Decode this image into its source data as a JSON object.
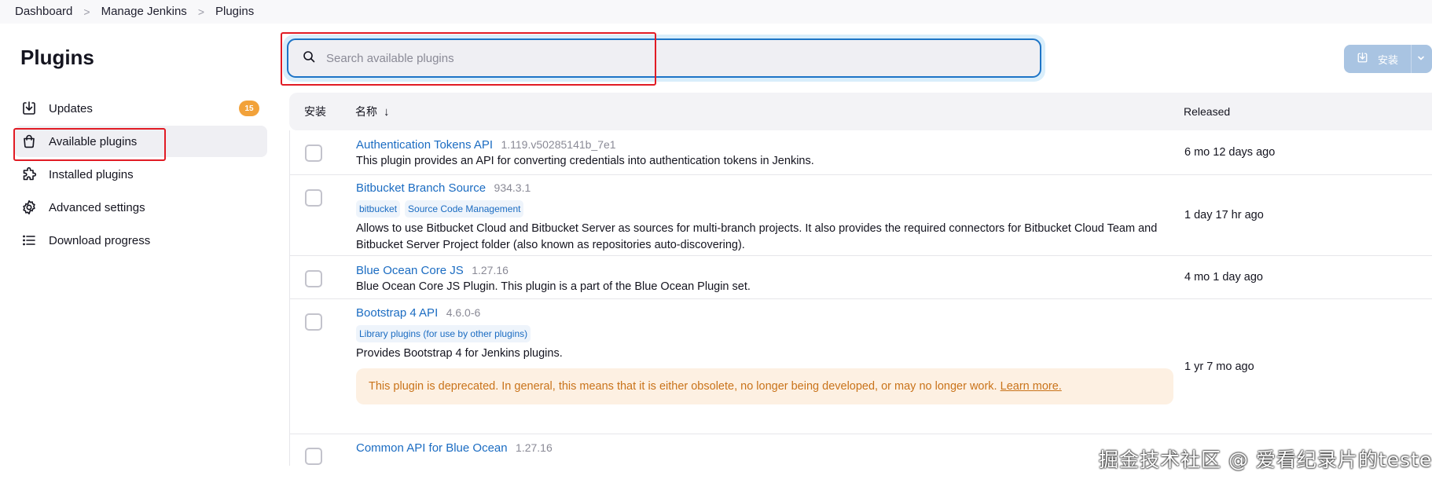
{
  "breadcrumb": [
    "Dashboard",
    "Manage Jenkins",
    "Plugins"
  ],
  "page_title": "Plugins",
  "sidebar": {
    "items": [
      {
        "label": "Updates",
        "icon": "download-icon",
        "badge": "15"
      },
      {
        "label": "Available plugins",
        "icon": "shopping-bag-icon",
        "active": true
      },
      {
        "label": "Installed plugins",
        "icon": "puzzle-icon"
      },
      {
        "label": "Advanced settings",
        "icon": "gear-icon"
      },
      {
        "label": "Download progress",
        "icon": "list-icon"
      }
    ]
  },
  "search": {
    "placeholder": "Search available plugins",
    "value": ""
  },
  "install_button": {
    "label": "安装"
  },
  "table": {
    "headers": {
      "install": "安装",
      "name": "名称",
      "name_sort": "↓",
      "released": "Released"
    },
    "rows": [
      {
        "name": "Authentication Tokens API",
        "version": "1.119.v50285141b_7e1",
        "tags": [],
        "description": "This plugin provides an API for converting credentials into authentication tokens in Jenkins.",
        "released": "6 mo 12 days ago"
      },
      {
        "name": "Bitbucket Branch Source",
        "version": "934.3.1",
        "tags": [
          "bitbucket",
          "Source Code Management"
        ],
        "description": "Allows to use Bitbucket Cloud and Bitbucket Server as sources for multi-branch projects. It also provides the required connectors for Bitbucket Cloud Team and Bitbucket Server Project folder (also known as repositories auto-discovering).",
        "released": "1 day 17 hr ago"
      },
      {
        "name": "Blue Ocean Core JS",
        "version": "1.27.16",
        "tags": [],
        "description": "Blue Ocean Core JS Plugin. This plugin is a part of the Blue Ocean Plugin set.",
        "released": "4 mo 1 day ago"
      },
      {
        "name": "Bootstrap 4 API",
        "version": "4.6.0-6",
        "tags": [
          "Library plugins (for use by other plugins)"
        ],
        "description": "Provides Bootstrap 4 for Jenkins plugins.",
        "warning": "This plugin is deprecated. In general, this means that it is either obsolete, no longer being developed, or may no longer work.",
        "warning_link": "Learn more.",
        "released": "1 yr 7 mo ago"
      },
      {
        "name": "Common API for Blue Ocean",
        "version": "1.27.16",
        "tags": [],
        "description": "",
        "released": ""
      }
    ]
  },
  "watermark": "掘金技术社区 @ 爱看纪录片的tester",
  "colors": {
    "link": "#1b6cc2",
    "badge": "#f2a23a",
    "annotation": "#e11b24",
    "warning_text": "#c9731a",
    "warning_bg": "#fdf0e2"
  }
}
